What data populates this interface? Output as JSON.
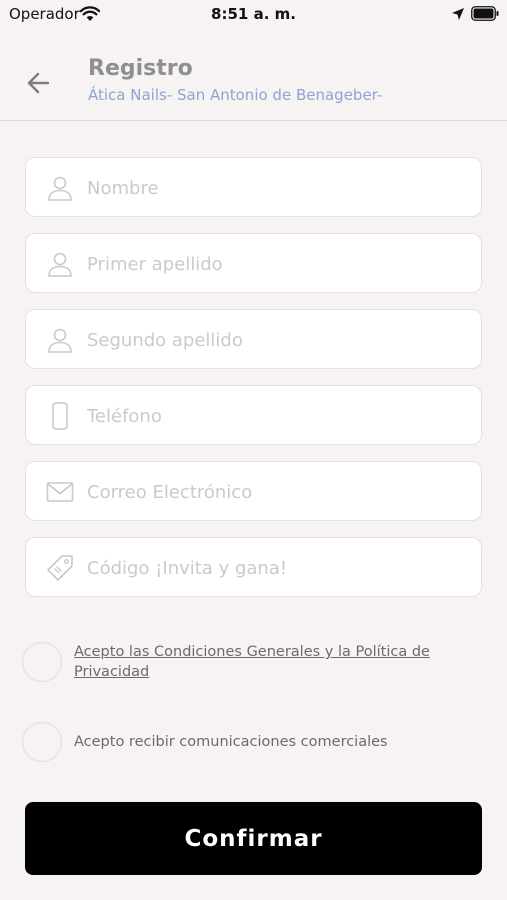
{
  "status_bar": {
    "carrier": "Operador",
    "time": "8:51 a. m."
  },
  "header": {
    "title": "Registro",
    "subtitle": "Ática Nails- San Antonio de Benageber-"
  },
  "form": {
    "nombre_placeholder": "Nombre",
    "apellido1_placeholder": "Primer apellido",
    "apellido2_placeholder": "Segundo apellido",
    "telefono_placeholder": "Teléfono",
    "email_placeholder": "Correo Electrónico",
    "codigo_placeholder": "Código ¡Invita y gana!"
  },
  "consents": {
    "terms_label": "Acepto las Condiciones Generales y la Política de Privacidad",
    "marketing_label": "Acepto recibir comunicaciones comerciales"
  },
  "actions": {
    "confirm_label": "Confirmar"
  },
  "icons": {
    "wifi": "wifi-icon",
    "location": "location-arrow-icon",
    "battery": "battery-icon",
    "back": "back-arrow-icon",
    "user": "user-icon",
    "phone": "phone-icon",
    "mail": "mail-icon",
    "tag": "tag-icon"
  },
  "colors": {
    "background": "#f6f3f2",
    "accent": "#8ea4d2",
    "button": "#000000"
  }
}
